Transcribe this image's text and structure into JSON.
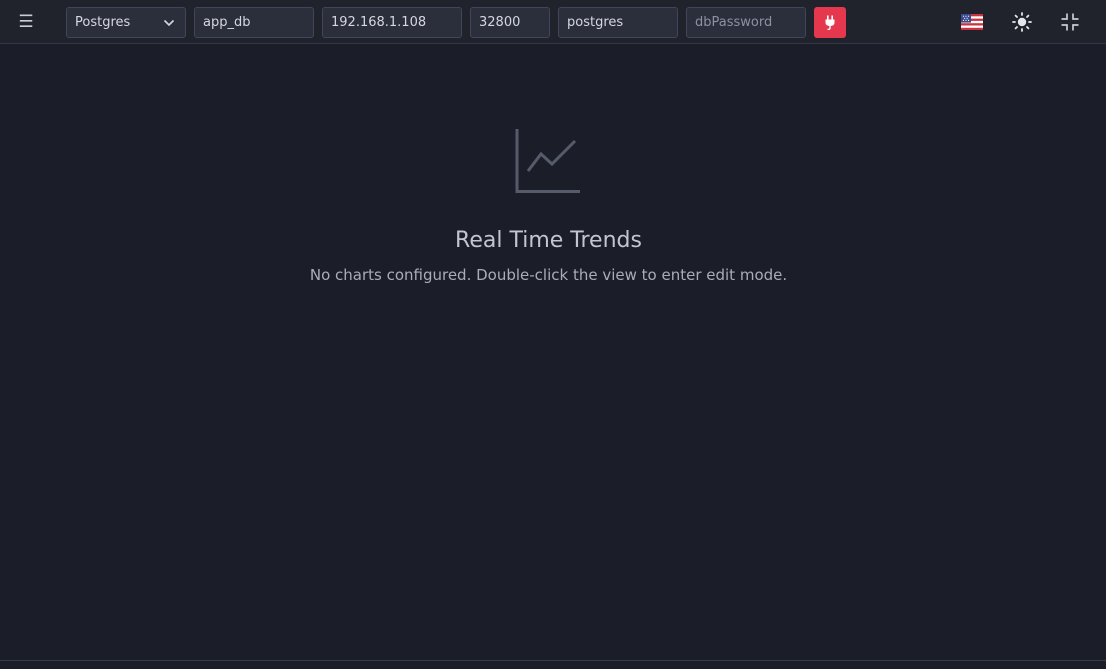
{
  "toolbar": {
    "menu_icon": "hamburger-menu-icon",
    "db_type": {
      "selected": "Postgres",
      "icon": "chevron-down-icon"
    },
    "database": {
      "value": "app_db"
    },
    "host": {
      "value": "192.168.1.108"
    },
    "port": {
      "value": "32800"
    },
    "user": {
      "value": "postgres"
    },
    "password": {
      "placeholder": "dbPassword"
    },
    "connect_button": {
      "icon": "plug-icon",
      "color": "#e5384f"
    },
    "language_icon": "us-flag-icon",
    "theme_icon": "sun-icon",
    "collapse_icon": "collapse-icon"
  },
  "main": {
    "icon": "line-chart-icon",
    "title": "Real Time Trends",
    "description": "No charts configured. Double-click the view to enter edit mode."
  }
}
